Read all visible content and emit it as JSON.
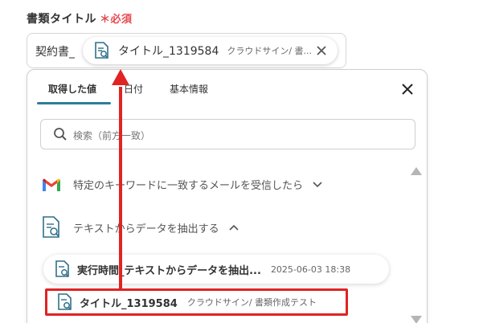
{
  "field": {
    "label": "書類タイトル",
    "required_mark": "＊",
    "required_text": "必須",
    "prefix": "契約書_"
  },
  "token": {
    "name": "タイトル_1319584",
    "source": "クラウドサイン/ 書..."
  },
  "tabs": [
    {
      "label": "取得した値",
      "active": true
    },
    {
      "label": "日付",
      "active": false
    },
    {
      "label": "基本情報",
      "active": false
    }
  ],
  "search": {
    "placeholder": "検索（前方一致）"
  },
  "groups": [
    {
      "label": "特定のキーワードに一致するメールを受信したら",
      "icon": "gmail-icon",
      "expanded": false
    },
    {
      "label": "テキストからデータを抽出する",
      "icon": "document-search-icon",
      "expanded": true
    }
  ],
  "items": [
    {
      "name": "実行時間_テキストからデータを抽出...",
      "meta": "2025-06-03 18:38"
    },
    {
      "name": "タイトル_1319584",
      "meta": "クラウドサイン/ 書類作成テスト"
    }
  ],
  "colors": {
    "accent": "#2e7d9b",
    "highlight": "#e02323",
    "required": "#e5484d"
  }
}
